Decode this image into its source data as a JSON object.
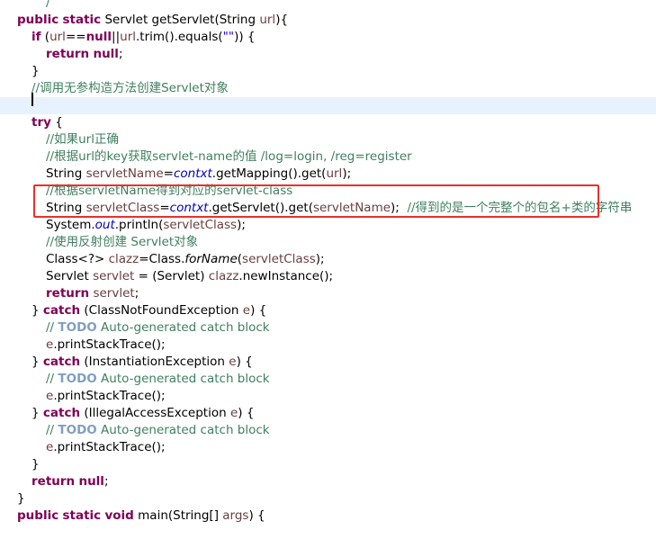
{
  "editor": {
    "lines": [
      {
        "indent": 3,
        "tokens": [
          {
            "t": "/",
            "c": "cm"
          }
        ]
      },
      {
        "indent": 1,
        "tokens": [
          {
            "t": "public",
            "c": "kw"
          },
          {
            "t": " "
          },
          {
            "t": "static",
            "c": "kw"
          },
          {
            "t": " Servlet getServlet(String "
          },
          {
            "t": "url",
            "c": "var"
          },
          {
            "t": "){"
          }
        ]
      },
      {
        "indent": 2,
        "tokens": [
          {
            "t": "if",
            "c": "kw"
          },
          {
            "t": " ("
          },
          {
            "t": "url",
            "c": "var"
          },
          {
            "t": "=="
          },
          {
            "t": "null",
            "c": "kw"
          },
          {
            "t": "||"
          },
          {
            "t": "url",
            "c": "var"
          },
          {
            "t": ".trim().equals("
          },
          {
            "t": "\"\"",
            "c": "st"
          },
          {
            "t": ")) {"
          }
        ]
      },
      {
        "indent": 3,
        "tokens": [
          {
            "t": "return",
            "c": "kw"
          },
          {
            "t": " "
          },
          {
            "t": "null",
            "c": "kw"
          },
          {
            "t": ";"
          }
        ]
      },
      {
        "indent": 2,
        "tokens": [
          {
            "t": "}"
          }
        ]
      },
      {
        "indent": 2,
        "tokens": [
          {
            "t": "//调用无参构造方法创建Servlet对象",
            "c": "cm"
          }
        ]
      },
      {
        "indent": 2,
        "current": true,
        "tokens": []
      },
      {
        "indent": 2,
        "tokens": [
          {
            "t": "try",
            "c": "kw"
          },
          {
            "t": " {"
          }
        ]
      },
      {
        "indent": 3,
        "tokens": [
          {
            "t": "//如果url正确",
            "c": "cm"
          }
        ]
      },
      {
        "indent": 3,
        "tokens": [
          {
            "t": "//根据url的key获取servlet-name的值 /log=login, /reg=register",
            "c": "cm"
          }
        ]
      },
      {
        "indent": 3,
        "tokens": [
          {
            "t": "String "
          },
          {
            "t": "servletName",
            "c": "var"
          },
          {
            "t": "="
          },
          {
            "t": "contxt",
            "c": "fld"
          },
          {
            "t": ".getMapping().get("
          },
          {
            "t": "url",
            "c": "var"
          },
          {
            "t": ");"
          }
        ]
      },
      {
        "indent": 3,
        "tokens": [
          {
            "t": "//根据servletName得到对应的servlet-class",
            "c": "cm"
          }
        ]
      },
      {
        "indent": 3,
        "tokens": [
          {
            "t": "String "
          },
          {
            "t": "servletClass",
            "c": "var"
          },
          {
            "t": "="
          },
          {
            "t": "contxt",
            "c": "fld"
          },
          {
            "t": ".getServlet().get("
          },
          {
            "t": "servletName",
            "c": "var"
          },
          {
            "t": ");  "
          },
          {
            "t": "//得到的是一个完整个的包名+类的字符串",
            "c": "cm"
          }
        ]
      },
      {
        "indent": 3,
        "tokens": [
          {
            "t": "System."
          },
          {
            "t": "out",
            "c": "fld"
          },
          {
            "t": ".println("
          },
          {
            "t": "servletClass",
            "c": "var"
          },
          {
            "t": ");"
          }
        ]
      },
      {
        "indent": 3,
        "tokens": [
          {
            "t": "//使用反射创建 Servlet对象",
            "c": "cm"
          }
        ]
      },
      {
        "indent": 3,
        "tokens": [
          {
            "t": "Class<?> "
          },
          {
            "t": "clazz",
            "c": "var"
          },
          {
            "t": "=Class."
          },
          {
            "t": "forName",
            "c": "it"
          },
          {
            "t": "("
          },
          {
            "t": "servletClass",
            "c": "var"
          },
          {
            "t": ");"
          }
        ]
      },
      {
        "indent": 3,
        "tokens": [
          {
            "t": "Servlet "
          },
          {
            "t": "servlet",
            "c": "var"
          },
          {
            "t": " = (Servlet) "
          },
          {
            "t": "clazz",
            "c": "var"
          },
          {
            "t": ".newInstance();"
          }
        ]
      },
      {
        "indent": 3,
        "tokens": [
          {
            "t": "return",
            "c": "kw"
          },
          {
            "t": " "
          },
          {
            "t": "servlet",
            "c": "var"
          },
          {
            "t": ";"
          }
        ]
      },
      {
        "indent": 2,
        "tokens": [
          {
            "t": "} "
          },
          {
            "t": "catch",
            "c": "kw"
          },
          {
            "t": " (ClassNotFoundException "
          },
          {
            "t": "e",
            "c": "var"
          },
          {
            "t": ") {"
          }
        ]
      },
      {
        "indent": 3,
        "tokens": [
          {
            "t": "// ",
            "c": "cm"
          },
          {
            "t": "TODO",
            "c": "tag"
          },
          {
            "t": " Auto-generated catch block",
            "c": "cm"
          }
        ]
      },
      {
        "indent": 3,
        "tokens": [
          {
            "t": "e",
            "c": "var"
          },
          {
            "t": ".printStackTrace();"
          }
        ]
      },
      {
        "indent": 2,
        "tokens": [
          {
            "t": "} "
          },
          {
            "t": "catch",
            "c": "kw"
          },
          {
            "t": " (InstantiationException "
          },
          {
            "t": "e",
            "c": "var"
          },
          {
            "t": ") {"
          }
        ]
      },
      {
        "indent": 3,
        "tokens": [
          {
            "t": "// ",
            "c": "cm"
          },
          {
            "t": "TODO",
            "c": "tag"
          },
          {
            "t": " Auto-generated catch block",
            "c": "cm"
          }
        ]
      },
      {
        "indent": 3,
        "tokens": [
          {
            "t": "e",
            "c": "var"
          },
          {
            "t": ".printStackTrace();"
          }
        ]
      },
      {
        "indent": 2,
        "tokens": [
          {
            "t": "} "
          },
          {
            "t": "catch",
            "c": "kw"
          },
          {
            "t": " (IllegalAccessException "
          },
          {
            "t": "e",
            "c": "var"
          },
          {
            "t": ") {"
          }
        ]
      },
      {
        "indent": 3,
        "tokens": [
          {
            "t": "// ",
            "c": "cm"
          },
          {
            "t": "TODO",
            "c": "tag"
          },
          {
            "t": " Auto-generated catch block",
            "c": "cm"
          }
        ]
      },
      {
        "indent": 3,
        "tokens": [
          {
            "t": "e",
            "c": "var"
          },
          {
            "t": ".printStackTrace();"
          }
        ]
      },
      {
        "indent": 2,
        "tokens": [
          {
            "t": "}"
          }
        ]
      },
      {
        "indent": 2,
        "tokens": [
          {
            "t": "return",
            "c": "kw"
          },
          {
            "t": " "
          },
          {
            "t": "null",
            "c": "kw"
          },
          {
            "t": ";"
          }
        ]
      },
      {
        "indent": 1,
        "tokens": [
          {
            "t": "}"
          }
        ]
      },
      {
        "indent": 1,
        "tokens": [
          {
            "t": "public",
            "c": "kw"
          },
          {
            "t": " "
          },
          {
            "t": "static",
            "c": "kw"
          },
          {
            "t": " "
          },
          {
            "t": "void",
            "c": "kw"
          },
          {
            "t": " main(String[] "
          },
          {
            "t": "args",
            "c": "var"
          },
          {
            "t": ") {"
          }
        ]
      }
    ]
  },
  "colors": {
    "background": "#ffffff",
    "keyword": "#7f0055",
    "comment": "#3f7f5f",
    "field": "#0000c0",
    "current_line": "#e8f2fe",
    "highlight_border": "#e8312a"
  }
}
